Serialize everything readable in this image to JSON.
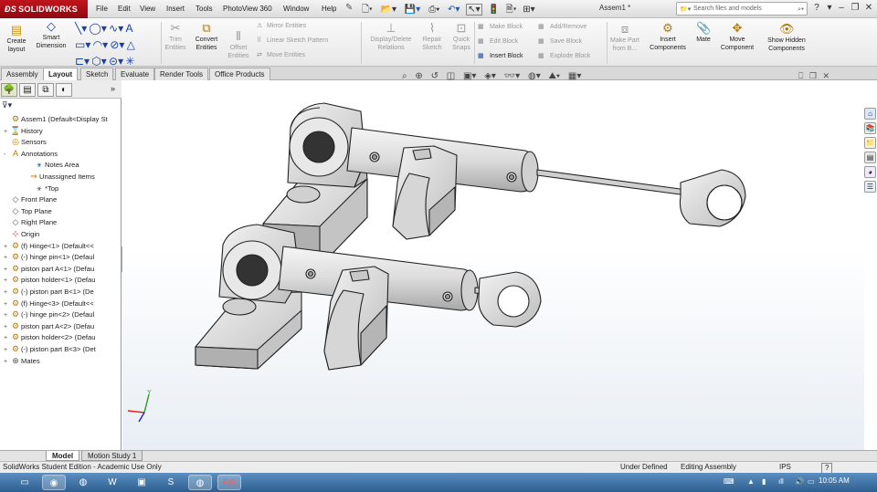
{
  "app": {
    "brand": "SOLIDWORKS",
    "doc_title": "Assem1 *",
    "menus": [
      "File",
      "Edit",
      "View",
      "Insert",
      "Tools",
      "PhotoView 360",
      "Window",
      "Help"
    ],
    "search_placeholder": "Search files and models"
  },
  "ribbon": {
    "create_layout": "Create layout",
    "smart_dimension": "Smart Dimension",
    "trim_entities": "Trim Entities",
    "convert_entities": "Convert Entities",
    "offset_entities": "Offset Entities",
    "mirror_entities": "Mirror Entities",
    "linear_sketch_pattern": "Linear Sketch Pattern",
    "move_entities": "Move Entities",
    "display_delete_relations": "Display/Delete Relations",
    "repair_sketch": "Repair Sketch",
    "quick_snaps": "Quick Snaps",
    "make_block": "Make Block",
    "edit_block": "Edit Block",
    "insert_block": "Insert Block",
    "add_remove": "Add/Remove",
    "save_block": "Save Block",
    "explode_block": "Explode Block",
    "make_part_from_block": "Make Part from B...",
    "insert_components": "Insert Components",
    "mate": "Mate",
    "move_component": "Move Component",
    "show_hidden_components": "Show Hidden Components"
  },
  "tabs": [
    "Assembly",
    "Layout",
    "Sketch",
    "Evaluate",
    "Render Tools",
    "Office Products"
  ],
  "active_tab": "Layout",
  "tree": [
    {
      "label": "Assem1  (Default<Display St",
      "icon": "assembly-icon",
      "exp": ""
    },
    {
      "label": "History",
      "icon": "history-icon",
      "exp": "+"
    },
    {
      "label": "Sensors",
      "icon": "sensors-icon",
      "exp": ""
    },
    {
      "label": "Annotations",
      "icon": "annotations-icon",
      "exp": "-"
    },
    {
      "label": "Notes Area",
      "icon": "notes-icon",
      "exp": ""
    },
    {
      "label": "Unassigned Items",
      "icon": "unassigned-icon",
      "exp": ""
    },
    {
      "label": "*Top",
      "icon": "view-icon",
      "exp": ""
    },
    {
      "label": "Front Plane",
      "icon": "plane-icon",
      "exp": ""
    },
    {
      "label": "Top Plane",
      "icon": "plane-icon",
      "exp": ""
    },
    {
      "label": "Right Plane",
      "icon": "plane-icon",
      "exp": ""
    },
    {
      "label": "Origin",
      "icon": "origin-icon",
      "exp": ""
    },
    {
      "label": "(f) Hinge<1> (Default<<",
      "icon": "part-icon",
      "exp": "+"
    },
    {
      "label": "(-) hinge pin<1> (Defaul",
      "icon": "part-icon",
      "exp": "+"
    },
    {
      "label": "piston part A<1> (Defau",
      "icon": "part-icon",
      "exp": "+"
    },
    {
      "label": "piston holder<1> (Defau",
      "icon": "part-icon",
      "exp": "+"
    },
    {
      "label": "(-) piston part B<1> (De",
      "icon": "part-icon",
      "exp": "+"
    },
    {
      "label": "(f) Hinge<3> (Default<<",
      "icon": "part-icon",
      "exp": "+"
    },
    {
      "label": "(-) hinge pin<2> (Defaul",
      "icon": "part-icon",
      "exp": "+"
    },
    {
      "label": "piston part A<2> (Defau",
      "icon": "part-icon",
      "exp": "+"
    },
    {
      "label": "piston holder<2> (Defau",
      "icon": "part-icon",
      "exp": "+"
    },
    {
      "label": "(-) piston part B<3> (Det",
      "icon": "part-icon",
      "exp": "+"
    },
    {
      "label": "Mates",
      "icon": "mates-icon",
      "exp": "+"
    }
  ],
  "model_tabs": [
    "Model",
    "Motion Study 1"
  ],
  "status": {
    "edition": "SolidWorks Student Edition - Academic Use Only",
    "definition": "Under Defined",
    "mode": "Editing Assembly",
    "units": "IPS",
    "help": "?"
  },
  "taskbar": {
    "time": "10:05 AM"
  }
}
